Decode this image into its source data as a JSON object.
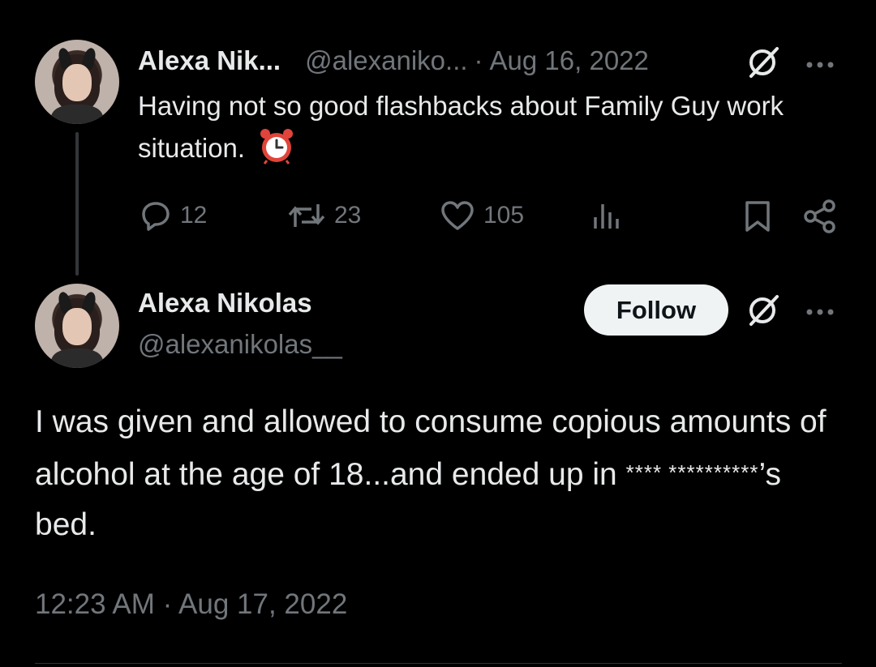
{
  "tweet1": {
    "name": "Alexa Nik...",
    "handle": "@alexaniko...",
    "separator": "·",
    "date": "Aug 16, 2022",
    "text": "Having not so good flashbacks about Family Guy work situation.",
    "emoji": "⏰",
    "replies": "12",
    "reposts": "23",
    "likes": "105"
  },
  "tweet2": {
    "name": "Alexa Nikolas",
    "handle": "@alexanikolas__",
    "follow_label": "Follow",
    "text_before": "I was given and allowed to consume copious amounts of alcohol at the age of 18...and ended up in ",
    "censored": "**** **********",
    "text_after": "’s bed.",
    "timestamp": "12:23 AM · Aug 17, 2022"
  },
  "icons": {
    "reply": "speech-bubble-icon",
    "repost": "repost-arrows-icon",
    "like": "heart-icon",
    "views": "bar-chart-icon",
    "bookmark": "bookmark-icon",
    "share": "share-icon",
    "grok": "grok-slash-icon",
    "more": "more-dots-icon"
  },
  "colors": {
    "background": "#000000",
    "text": "#e7e9ea",
    "muted": "#71767b",
    "button": "#eff3f4"
  }
}
